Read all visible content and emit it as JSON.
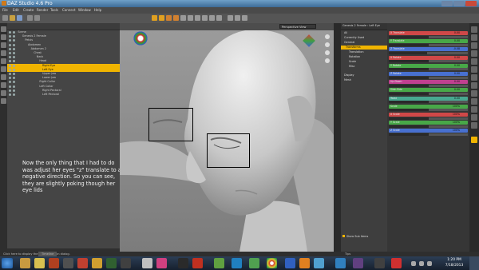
{
  "window": {
    "title": "DAZ Studio 4.6 Pro"
  },
  "menu": [
    "File",
    "Edit",
    "Create",
    "Render",
    "Tools",
    "Connect",
    "Window",
    "Help"
  ],
  "scene": {
    "nodes": [
      {
        "label": "Scene"
      },
      {
        "label": "Genesis 2 Female"
      },
      {
        "label": "Pelvis"
      },
      {
        "label": "Abdomen"
      },
      {
        "label": "Abdomen 2"
      },
      {
        "label": "Chest"
      },
      {
        "label": "Neck"
      },
      {
        "label": "Head"
      },
      {
        "label": "Right Eye"
      },
      {
        "label": "Left Eye"
      },
      {
        "label": "Upper Jaw"
      },
      {
        "label": "Lower Jaw"
      },
      {
        "label": "Right Collar"
      },
      {
        "label": "Left Collar"
      },
      {
        "label": "Right Pectoral"
      },
      {
        "label": "Left Pectoral"
      }
    ],
    "selected": "Left Eye"
  },
  "annotation": "Now the only thing that I had to do was adjust her eyes \"z\" translate to a negative direction. So you can see, they are slightly poking though her eye lids",
  "viewport": {
    "view": "Perspective View"
  },
  "parameters": {
    "node": "Genesis 2 Female : Left Eye",
    "items": [
      {
        "label": "All"
      },
      {
        "label": "Currently Used"
      },
      {
        "label": "General"
      },
      {
        "label": "Transforms"
      },
      {
        "label": "Translation"
      },
      {
        "label": "Rotation"
      },
      {
        "label": "Scale"
      },
      {
        "label": "Misc"
      },
      {
        "label": "Display"
      },
      {
        "label": "Mesh"
      }
    ],
    "selected": "Transforms",
    "show_sub_items": "Show Sub Items"
  },
  "sliders": [
    {
      "name": "X Translate",
      "value": "0.00",
      "color": "#d04848",
      "fill": 0.5
    },
    {
      "name": "Y Translate",
      "value": "0.00",
      "color": "#48a848",
      "fill": 0.5
    },
    {
      "name": "Z Translate",
      "value": "-0.08",
      "color": "#4870d0",
      "fill": 0.48
    },
    {
      "name": "X Rotate",
      "value": "0.00",
      "color": "#d04848",
      "fill": 0.5
    },
    {
      "name": "Y Rotate",
      "value": "0.00",
      "color": "#48a848",
      "fill": 0.5
    },
    {
      "name": "Z Rotate",
      "value": "0.00",
      "color": "#4870d0",
      "fill": 0.5
    },
    {
      "name": "Up-Down",
      "value": "0.00",
      "color": "#c04090",
      "fill": 0.5
    },
    {
      "name": "Side-Side",
      "value": "0.00",
      "color": "#48a848",
      "fill": 0.5
    },
    {
      "name": "Twist",
      "value": "0.00",
      "color": "#48a890",
      "fill": 0.5
    },
    {
      "name": "Scale",
      "value": "100%",
      "color": "#48a848",
      "fill": 0.5
    },
    {
      "name": "X Scale",
      "value": "100%",
      "color": "#d04848",
      "fill": 0.5
    },
    {
      "name": "Y Scale",
      "value": "100%",
      "color": "#48a848",
      "fill": 0.5
    },
    {
      "name": "Z Scale",
      "value": "100%",
      "color": "#4870d0",
      "fill": 0.5
    }
  ],
  "status": {
    "left": "Click here to display the Tertiary Action dialog.",
    "tab": "Timeline",
    "tab2": "Tips"
  },
  "taskbar": {
    "time": "1:20 PM",
    "date": "7/18/2013"
  }
}
